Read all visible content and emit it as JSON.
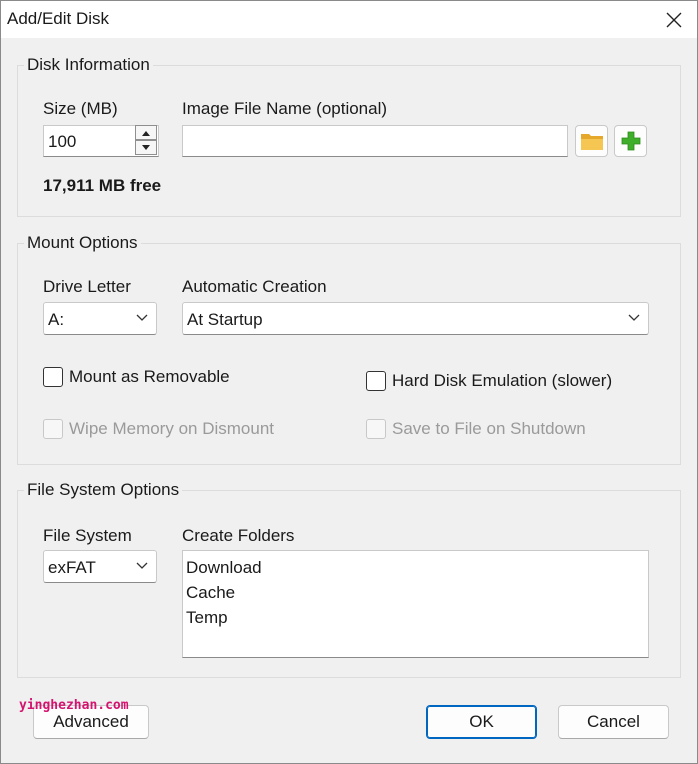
{
  "window": {
    "title": "Add/Edit Disk"
  },
  "disk_info": {
    "legend": "Disk Information",
    "size_label": "Size (MB)",
    "size_value": "100",
    "image_label": "Image File Name (optional)",
    "image_value": "",
    "free_text": "17,911 MB free"
  },
  "mount": {
    "legend": "Mount Options",
    "drive_letter_label": "Drive Letter",
    "drive_letter_value": "A:",
    "auto_creation_label": "Automatic Creation",
    "auto_creation_value": "At Startup",
    "removable_label": "Mount as Removable",
    "hdd_emulation_label": "Hard Disk Emulation (slower)",
    "wipe_label": "Wipe Memory on Dismount",
    "save_label": "Save to File on Shutdown"
  },
  "fs": {
    "legend": "File System Options",
    "fs_label": "File System",
    "fs_value": "exFAT",
    "folders_label": "Create Folders",
    "folders": [
      "Download",
      "Cache",
      "Temp"
    ]
  },
  "buttons": {
    "advanced": "Advanced",
    "ok": "OK",
    "cancel": "Cancel"
  },
  "watermark": "yinghezhan.com",
  "colors": {
    "accent": "#0067c0",
    "folder": "#f5b93a",
    "plus": "#3fae2a",
    "watermark": "#d4136f"
  }
}
